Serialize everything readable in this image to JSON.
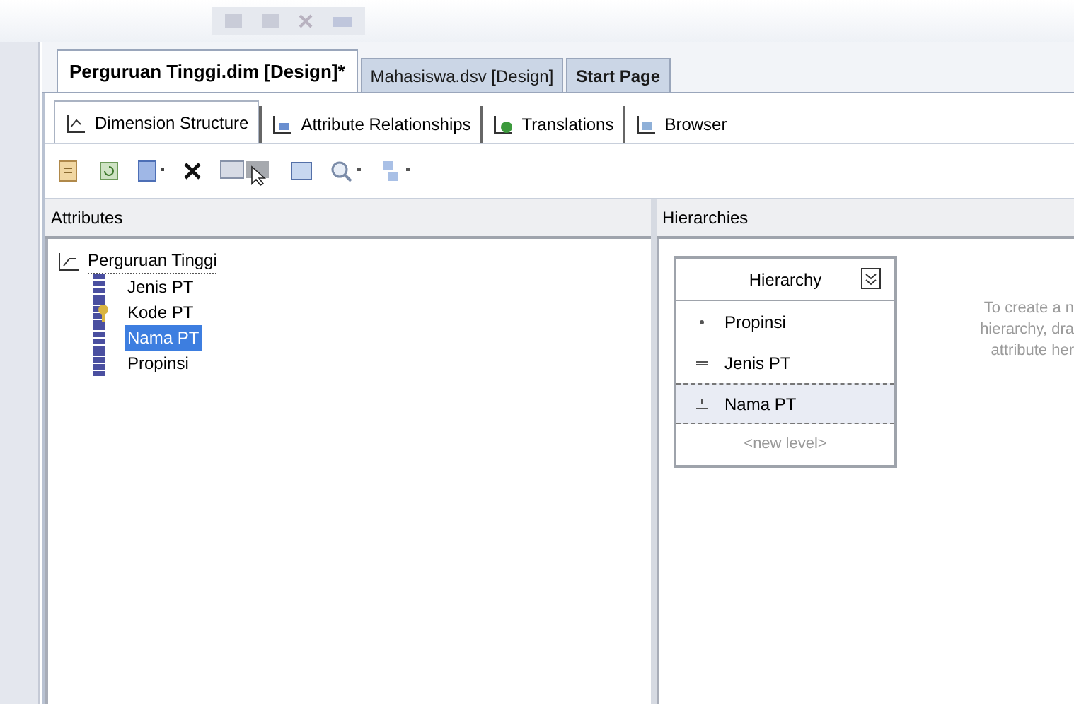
{
  "document_tabs": [
    {
      "label": "Perguruan Tinggi.dim [Design]*",
      "selected": true
    },
    {
      "label": "Mahasiswa.dsv [Design]",
      "selected": false
    },
    {
      "label": "Start Page",
      "selected": false
    }
  ],
  "designer_tabs": [
    {
      "label": "Dimension Structure",
      "selected": true
    },
    {
      "label": "Attribute Relationships",
      "selected": false
    },
    {
      "label": "Translations",
      "selected": false
    },
    {
      "label": "Browser",
      "selected": false
    }
  ],
  "attributes_pane": {
    "title": "Attributes",
    "dimension": "Perguruan Tinggi",
    "items": [
      {
        "label": "Jenis PT",
        "kind": "attribute",
        "selected": false
      },
      {
        "label": "Kode PT",
        "kind": "key",
        "selected": false
      },
      {
        "label": "Nama PT",
        "kind": "attribute",
        "selected": true
      },
      {
        "label": "Propinsi",
        "kind": "attribute",
        "selected": false
      }
    ]
  },
  "hierarchies_pane": {
    "title": "Hierarchies",
    "hierarchy": {
      "name": "Hierarchy",
      "levels": [
        {
          "label": "Propinsi",
          "selected": false
        },
        {
          "label": "Jenis PT",
          "selected": false
        },
        {
          "label": "Nama PT",
          "selected": true
        }
      ],
      "new_level": "<new level>"
    },
    "hint_lines": [
      "To create a n",
      "hierarchy, dra",
      "attribute her"
    ]
  }
}
